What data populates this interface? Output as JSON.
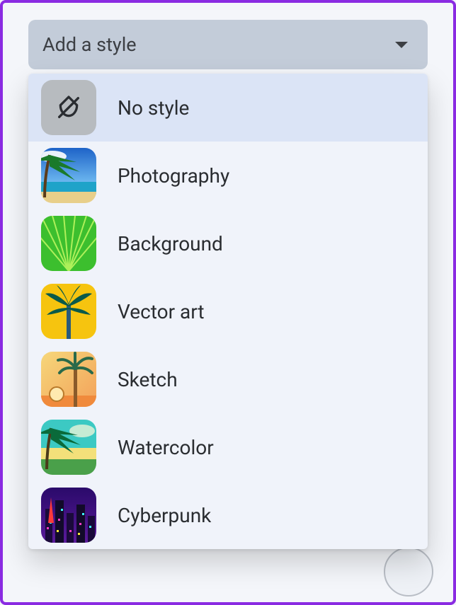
{
  "dropdown": {
    "trigger_label": "Add a style",
    "options": [
      {
        "label": "No style"
      },
      {
        "label": "Photography"
      },
      {
        "label": "Background"
      },
      {
        "label": "Vector art"
      },
      {
        "label": "Sketch"
      },
      {
        "label": "Watercolor"
      },
      {
        "label": "Cyberpunk"
      }
    ],
    "selected_index": 0
  }
}
